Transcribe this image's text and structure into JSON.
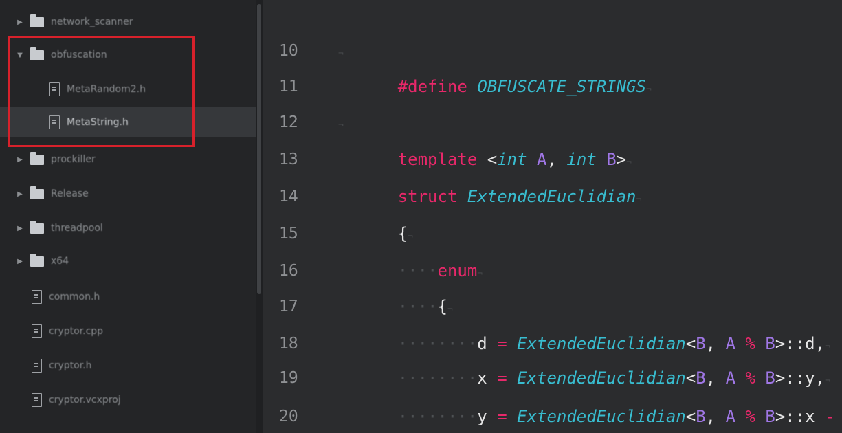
{
  "sidebar": {
    "items": [
      {
        "type": "folder",
        "arrow": "▶",
        "label": "network_scanner"
      },
      {
        "type": "folder",
        "arrow": "▼",
        "label": "obfuscation"
      },
      {
        "type": "file",
        "label": "MetaRandom2.h"
      },
      {
        "type": "file",
        "label": "MetaString.h"
      },
      {
        "type": "folder",
        "arrow": "▶",
        "label": "prockiller"
      },
      {
        "type": "folder",
        "arrow": "▶",
        "label": "Release"
      },
      {
        "type": "folder",
        "arrow": "▶",
        "label": "threadpool"
      },
      {
        "type": "folder",
        "arrow": "▶",
        "label": "x64"
      },
      {
        "type": "file",
        "label": "common.h"
      },
      {
        "type": "file",
        "label": "cryptor.cpp"
      },
      {
        "type": "file",
        "label": "cryptor.h"
      },
      {
        "type": "file",
        "label": "cryptor.vcxproj"
      }
    ],
    "selected_index": 3
  },
  "editor": {
    "line_numbers": [
      "10",
      "11",
      "12",
      "13",
      "14",
      "15",
      "16",
      "17",
      "18",
      "19",
      "20"
    ],
    "tokens": {
      "define_kw": "#define",
      "macro_name": "OBFUSCATE_STRINGS",
      "template_kw": "template",
      "lt": "<",
      "gt": ">",
      "int_kw": "int",
      "param_a": "A",
      "param_b": "B",
      "comma": ",",
      "struct_kw": "struct",
      "struct_name": "ExtendedEuclidian",
      "open_brace": "{",
      "enum_kw": "enum",
      "var_d": "d",
      "var_x": "x",
      "var_y": "y",
      "assign": "=",
      "mod": "%",
      "scope_d": "::d,",
      "scope_y": "::y,",
      "scope_x": "::x",
      "minus": "-",
      "eol_marker": "¬",
      "indent_1": "····",
      "indent_2": "········"
    }
  },
  "colors": {
    "keyword": "#e8286a",
    "type": "#38bdd0",
    "template_param": "#a077e6",
    "highlight_box": "#d7212b"
  }
}
